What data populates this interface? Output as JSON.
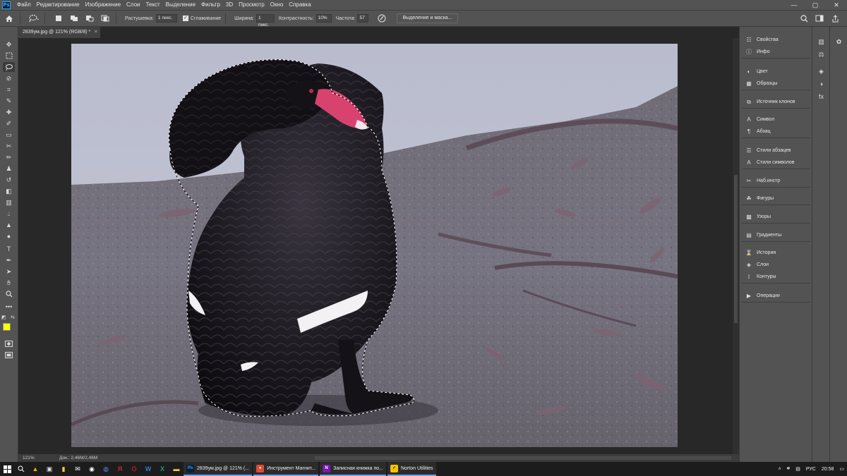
{
  "app": {
    "logo": "Ps",
    "menu": [
      "Файл",
      "Редактирование",
      "Изображение",
      "Слои",
      "Текст",
      "Выделение",
      "Фильтр",
      "3D",
      "Просмотр",
      "Окно",
      "Справка"
    ],
    "window_controls": [
      "—",
      "▢",
      "✕"
    ]
  },
  "options": {
    "feather_label": "Растушевка:",
    "feather_value": "1 пикс.",
    "antialias_label": "Сглаживание",
    "width_label": "Ширина:",
    "width_value": "1 пикс.",
    "contrast_label": "Контрастность:",
    "contrast_value": "10%",
    "frequency_label": "Частота:",
    "frequency_value": "57",
    "select_mask_button": "Выделение и маска..."
  },
  "document": {
    "tab_title": "2839ум.jpg @ 121% (RGB/8) *",
    "tab_close": "×"
  },
  "status": {
    "zoom": "121%",
    "doc_size": "Док.: 2,46M/2,46M"
  },
  "panels": {
    "groups": [
      [
        {
          "label": "Свойства",
          "icon": "properties-icon"
        },
        {
          "label": "Инфо",
          "icon": "info-icon"
        }
      ],
      [
        {
          "label": "Цвет",
          "icon": "color-icon"
        },
        {
          "label": "Образцы",
          "icon": "swatches-icon"
        }
      ],
      [
        {
          "label": "Источник клонов",
          "icon": "clone-source-icon"
        }
      ],
      [
        {
          "label": "Символ",
          "icon": "character-icon"
        },
        {
          "label": "Абзац",
          "icon": "paragraph-icon"
        }
      ],
      [
        {
          "label": "Стили абзацев",
          "icon": "paragraph-styles-icon"
        },
        {
          "label": "Стили символов",
          "icon": "character-styles-icon"
        }
      ],
      [
        {
          "label": "Наб.инстр",
          "icon": "tool-presets-icon"
        }
      ],
      [
        {
          "label": "Фигуры",
          "icon": "shapes-icon"
        }
      ],
      [
        {
          "label": "Узоры",
          "icon": "patterns-icon"
        }
      ],
      [
        {
          "label": "Градиенты",
          "icon": "gradients-icon"
        }
      ],
      [
        {
          "label": "История",
          "icon": "history-icon"
        },
        {
          "label": "Слои",
          "icon": "layers-icon"
        },
        {
          "label": "Контуры",
          "icon": "paths-icon"
        }
      ],
      [
        {
          "label": "Операции",
          "icon": "actions-icon"
        }
      ]
    ]
  },
  "colors": {
    "foreground": "#ffff00",
    "background": "#000000",
    "accent": "#31a8ff"
  },
  "taskbar": {
    "apps": [
      {
        "label": "2839ум.jpg @ 121% (...",
        "icon": "photoshop-icon",
        "badge": "Ps",
        "color": "#0b1e36"
      },
      {
        "label": "Инструмент Магнит...",
        "icon": "chrome-icon",
        "badge": "●",
        "color": "#dd4b39"
      },
      {
        "label": "Записная книжка по...",
        "icon": "onenote-icon",
        "badge": "N",
        "color": "#7719aa"
      },
      {
        "label": "Norton Utilities",
        "icon": "norton-icon",
        "badge": "✓",
        "color": "#f4c400"
      }
    ],
    "lang": "РУС",
    "time": "20:58"
  }
}
